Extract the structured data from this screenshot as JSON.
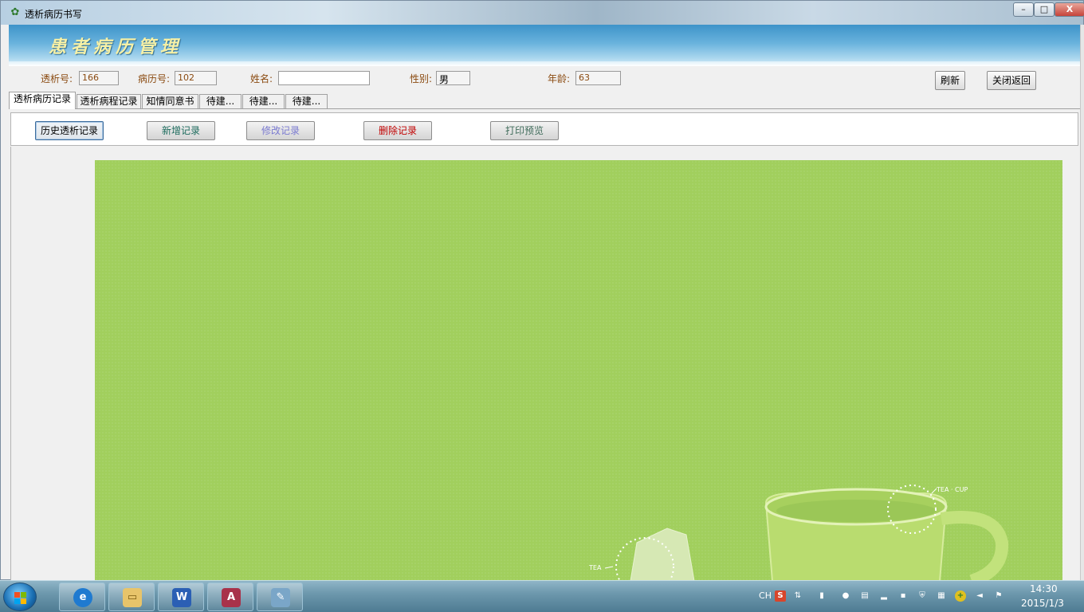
{
  "window": {
    "title": "透析病历书写",
    "minimize": "–",
    "maximize": "□",
    "close": "X"
  },
  "banner": {
    "title": "患者病历管理"
  },
  "patient": {
    "dialysis_no_label": "透析号:",
    "dialysis_no": "166",
    "record_no_label": "病历号:",
    "record_no": "102",
    "name_label": "姓名:",
    "name": "",
    "gender_label": "性别:",
    "gender": "男",
    "age_label": "年龄:",
    "age": "63"
  },
  "header_buttons": {
    "refresh": "刷新",
    "close_return": "关闭返回"
  },
  "tabs": [
    {
      "label": "透析病历记录",
      "active": true
    },
    {
      "label": "透析病程记录",
      "active": false
    },
    {
      "label": "知情同意书",
      "active": false
    },
    {
      "label": "待建...",
      "active": false
    },
    {
      "label": "待建...",
      "active": false
    },
    {
      "label": "待建...",
      "active": false
    }
  ],
  "toolbar": {
    "history": "历史透析记录",
    "new_record": "新增记录",
    "edit_record": "修改记录",
    "delete_record": "删除记录",
    "print_preview": "打印预览"
  },
  "colors": {
    "new_record": "#1d6b5d",
    "edit_record": "#7a7ad0",
    "delete_record": "#c00000",
    "print_preview": "#3f6b5a",
    "canvas_bg": "#a1cf5d"
  },
  "canvas_art": {
    "cup_text": "TEA · CUP",
    "bag_text": "TEA"
  },
  "taskbar": {
    "apps": [
      "ie-icon",
      "explorer-icon",
      "word-icon",
      "access-icon",
      "paint-icon"
    ],
    "tray_lang": "CH",
    "time": "14:30",
    "date": "2015/1/3"
  }
}
